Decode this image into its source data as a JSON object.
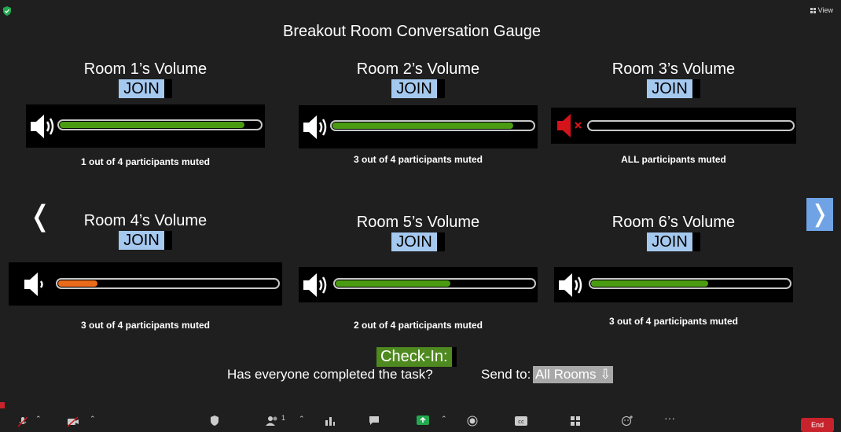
{
  "view_label": "View",
  "title": "Breakout Room Conversation Gauge",
  "join_label": "JOIN",
  "rooms": [
    {
      "title": "Room 1’s Volume",
      "muted_text": "1 out of 4 participants muted",
      "level": 0.92,
      "fill_color": "#4a9b12",
      "speaker": "speaker-icon"
    },
    {
      "title": "Room 2’s Volume",
      "muted_text": "3 out of 4 participants muted",
      "level": 0.9,
      "fill_color": "#4a9b12",
      "speaker": "speaker-icon"
    },
    {
      "title": "Room 3’s Volume",
      "muted_text": "ALL participants muted",
      "level": 0.0,
      "fill_color": "#4a9b12",
      "speaker": "speaker-muted-icon"
    },
    {
      "title": "Room 4’s Volume",
      "muted_text": "3 out of 4 participants muted",
      "level": 0.18,
      "fill_color": "#e86a1a",
      "speaker": "speaker-low-icon"
    },
    {
      "title": "Room 5’s Volume",
      "muted_text": "2 out of 4 participants muted",
      "level": 0.58,
      "fill_color": "#4a9b12",
      "speaker": "speaker-icon"
    },
    {
      "title": "Room 6’s Volume",
      "muted_text": "3 out of 4 participants muted",
      "level": 0.59,
      "fill_color": "#4a9b12",
      "speaker": "speaker-icon"
    }
  ],
  "nav": {
    "prev": "❬",
    "next": "❭"
  },
  "checkin": {
    "label": "Check-In:",
    "question": "Has everyone completed the task?",
    "send_to": "Send to:",
    "target": "All Rooms ⇩"
  },
  "toolbar": {
    "participants_count": "1",
    "end_label": "End"
  },
  "colors": {
    "join_bg": "#a4c8ee",
    "checkin_bg": "#4e8a1f",
    "green": "#4a9b12",
    "orange": "#e86a1a",
    "end_bg": "#c8232c"
  }
}
